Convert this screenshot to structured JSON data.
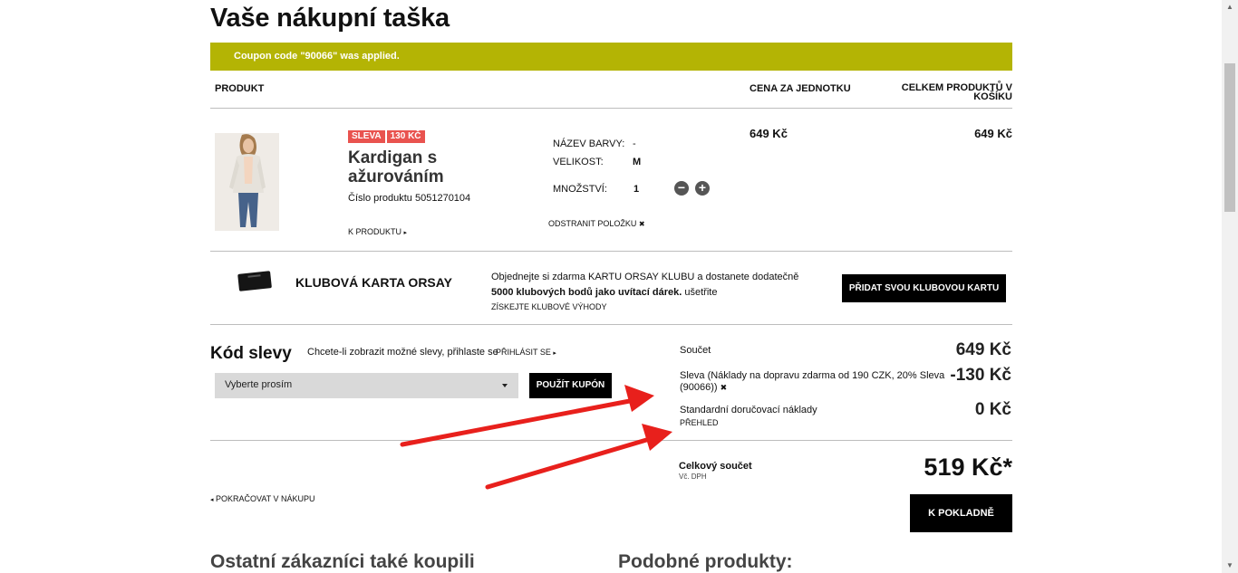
{
  "page": {
    "title": "Vaše nákupní taška"
  },
  "coupon_message": "Coupon code \"90066\" was applied.",
  "table_headers": {
    "product": "PRODUKT",
    "unit_price": "CENA ZA JEDNOTKU",
    "total": "CELKEM PRODUKTŮ V KOŠÍKU"
  },
  "item": {
    "badge_sale": "SLEVA",
    "badge_amount": "130 KČ",
    "name": "Kardigan s ažurováním",
    "product_number": "Číslo produktu 5051270104",
    "link_label": "K PRODUKTU",
    "color_label": "NÁZEV BARVY:",
    "color_value": "-",
    "size_label": "VELIKOST:",
    "size_value": "M",
    "qty_label": "MNOŽSTVÍ:",
    "qty_value": "1",
    "remove_label": "ODSTRANIT POLOŽKU",
    "unit_price": "649 Kč",
    "total_price": "649 Kč"
  },
  "club": {
    "title": "KLUBOVÁ KARTA ORSAY",
    "text_line1": "Objednejte si zdarma KARTU ORSAY KLUBU a dostanete dodatečně",
    "text_bold": "5000 klubových bodů jako uvítací dárek.",
    "text_after": " ušetřite",
    "link": "ZÍSKEJTE KLUBOVÉ VÝHODY",
    "button": "PŘIDAT SVOU KLUBOVOU KARTU"
  },
  "discount": {
    "title": "Kód slevy",
    "login_hint": "Chcete-li zobrazit možné slevy, přihlaste se",
    "login_link": "PŘIHLÁSIT SE",
    "select_value": "Vyberte prosím",
    "apply_button": "POUŽÍT KUPÓN"
  },
  "summary": {
    "subtotal_label": "Součet",
    "subtotal_value": "649 Kč",
    "discount_label_line1": "Sleva (Náklady na dopravu zdarma od 190 CZK, 20% Sleva",
    "discount_label_line2": "(90066))",
    "discount_value": "-130 Kč",
    "shipping_label": "Standardní doručovací náklady",
    "shipping_link": "PŘEHLED",
    "shipping_value": "0 Kč",
    "total_label": "Celkový součet",
    "vat_note": "Vč. DPH",
    "total_value": "519 Kč*",
    "checkout_button": "K POKLADNĚ"
  },
  "continue_link": "POKRAČOVAT V NÁKUPU",
  "bottom": {
    "others_bought": "Ostatní zákazníci také koupili",
    "similar": "Podobné produkty:"
  },
  "colors": {
    "coupon_bar": "#b4b404",
    "badge": "#e9534f",
    "arrow": "#e8201c"
  }
}
